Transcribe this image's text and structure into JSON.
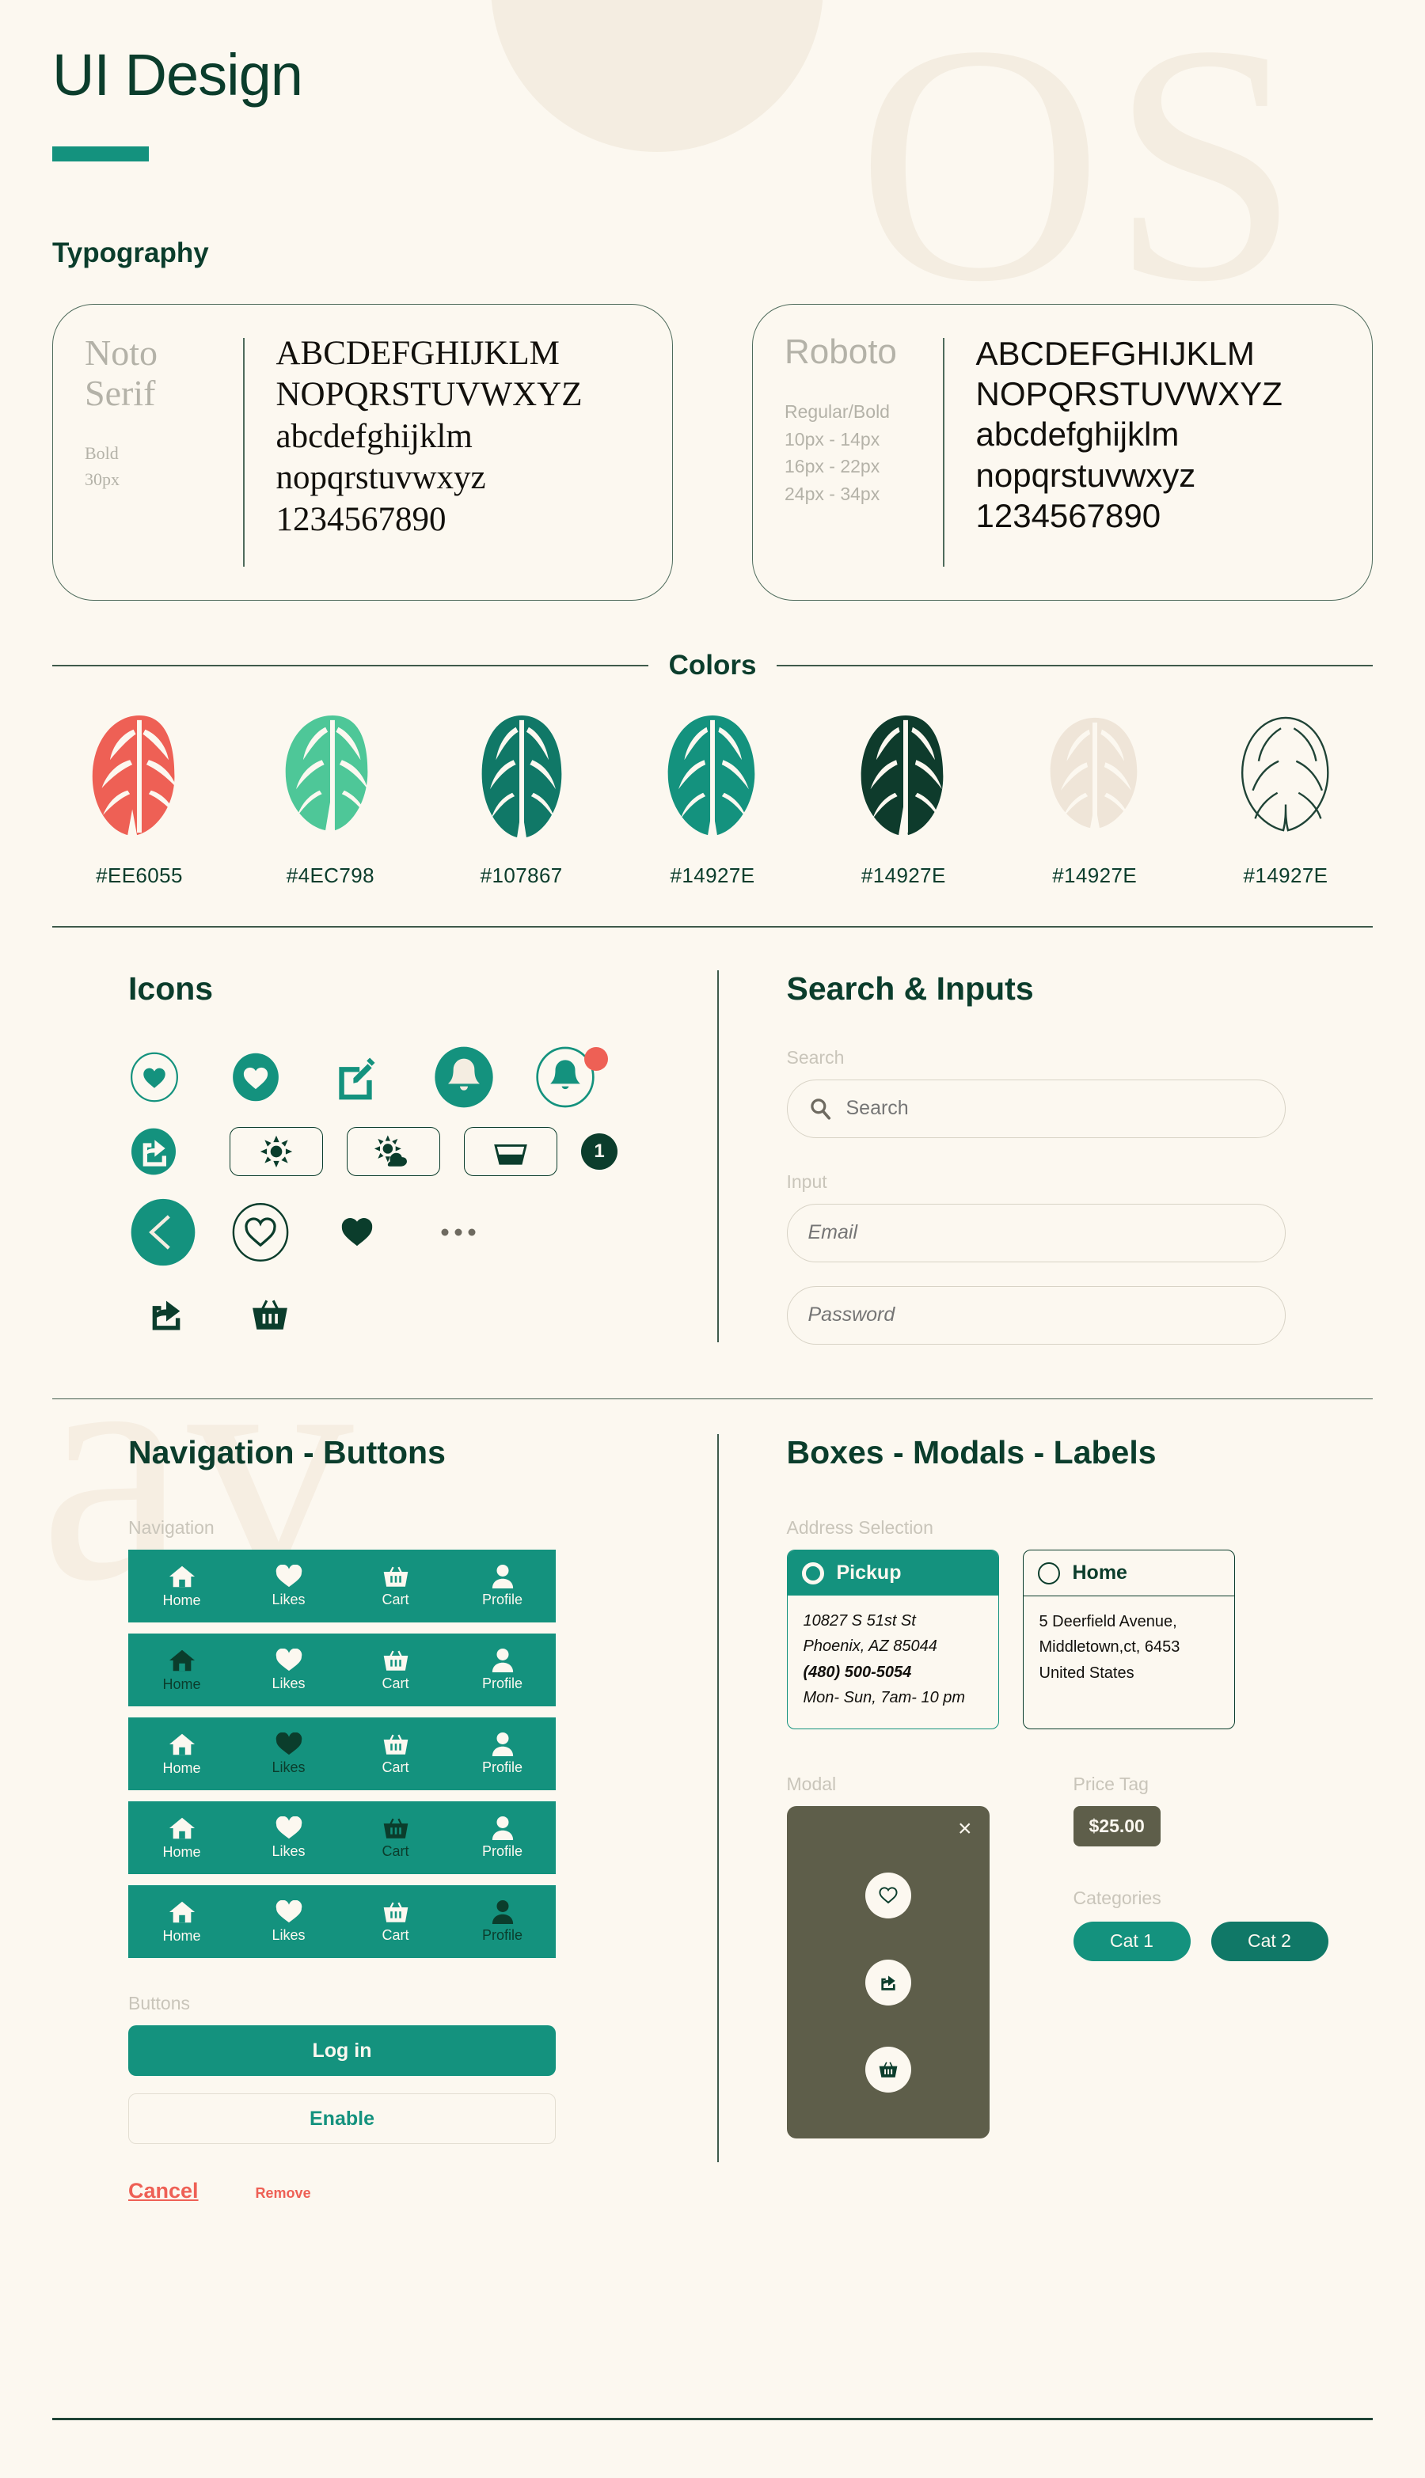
{
  "header": {
    "title": "UI Design"
  },
  "decor": {
    "letters_top": "OS",
    "letters_mid": "av"
  },
  "typography": {
    "heading": "Typography",
    "cards": [
      {
        "name": "Noto Serif",
        "spec": "Bold\n30px",
        "sample": "ABCDEFGHIJKLM\nNOPQRSTUVWXYZ\nabcdefghijklm\nnopqrstuvwxyz\n1234567890"
      },
      {
        "name": "Roboto",
        "spec": "Regular/Bold\n10px - 14px\n16px - 22px\n24px - 34px",
        "sample": "ABCDEFGHIJKLM\nNOPQRSTUVWXYZ\nabcdefghijklm\nnopqrstuvwxyz\n1234567890"
      }
    ]
  },
  "colors": {
    "heading": "Colors",
    "swatches": [
      {
        "hex": "#EE6055",
        "fill": "#EE6055",
        "style": "solid"
      },
      {
        "hex": "#4EC798",
        "fill": "#4EC798",
        "style": "solid"
      },
      {
        "hex": "#107867",
        "fill": "#107867",
        "style": "solid"
      },
      {
        "hex": "#14927E",
        "fill": "#14927E",
        "style": "solid"
      },
      {
        "hex": "#14927E",
        "fill": "#0E3B2C",
        "style": "solid"
      },
      {
        "hex": "#14927E",
        "fill": "#EFE5D8",
        "style": "solid"
      },
      {
        "hex": "#14927E",
        "fill": "none",
        "style": "outline"
      }
    ]
  },
  "icons": {
    "heading": "Icons",
    "row1": [
      "heart-outline-circle-icon",
      "heart-filled-circle-icon",
      "edit-square-icon",
      "bell-filled-circle-icon",
      "bell-badge-circle-icon"
    ],
    "row2": [
      "share-filled-circle-icon",
      "sun-box-icon",
      "cloud-sun-box-icon",
      "basket-box-icon",
      "count-badge"
    ],
    "row3": [
      "back-chevron-circle-icon",
      "heart-outline-circle-lg-icon",
      "heart-solid-icon",
      "ellipsis-icon"
    ],
    "row4": [
      "share-icon",
      "basket-icon"
    ],
    "badge_count": "1"
  },
  "search_inputs": {
    "heading": "Search & Inputs",
    "search_label": "Search",
    "search_placeholder": "Search",
    "input_label": "Input",
    "email_placeholder": "Email",
    "password_placeholder": "Password"
  },
  "navigation": {
    "heading": "Navigation - Buttons",
    "nav_label": "Navigation",
    "items": [
      "Home",
      "Likes",
      "Cart",
      "Profile"
    ],
    "bars": [
      {
        "active": -1
      },
      {
        "active": 0
      },
      {
        "active": 1
      },
      {
        "active": 2
      },
      {
        "active": 3
      }
    ],
    "buttons_label": "Buttons",
    "login": "Log in",
    "enable": "Enable",
    "cancel": "Cancel",
    "remove": "Remove"
  },
  "boxes": {
    "heading": "Boxes - Modals - Labels",
    "address_label": "Address Selection",
    "pickup": {
      "title": "Pickup",
      "line1": "10827 S 51st St",
      "line2": "Phoenix, AZ 85044",
      "phone": "(480) 500-5054",
      "hours": "Mon- Sun, 7am- 10 pm"
    },
    "home": {
      "title": "Home",
      "line1": "5 Deerfield Avenue,",
      "line2": "Middletown,ct, 6453",
      "line3": "United States"
    },
    "modal_label": "Modal",
    "modal_close": "×",
    "modal_actions": [
      "heart-outline-icon",
      "share-icon",
      "basket-icon"
    ],
    "price_label": "Price Tag",
    "price_value": "$25.00",
    "categories_label": "Categories",
    "categories": [
      "Cat 1",
      "Cat 2"
    ]
  },
  "palette": {
    "bg": "#FCF8F0",
    "teal": "#14927E",
    "teal_dark": "#107867",
    "forest": "#0B3D2C",
    "coral": "#EE6055",
    "mint": "#4EC798",
    "olive": "#5E5E4A"
  }
}
